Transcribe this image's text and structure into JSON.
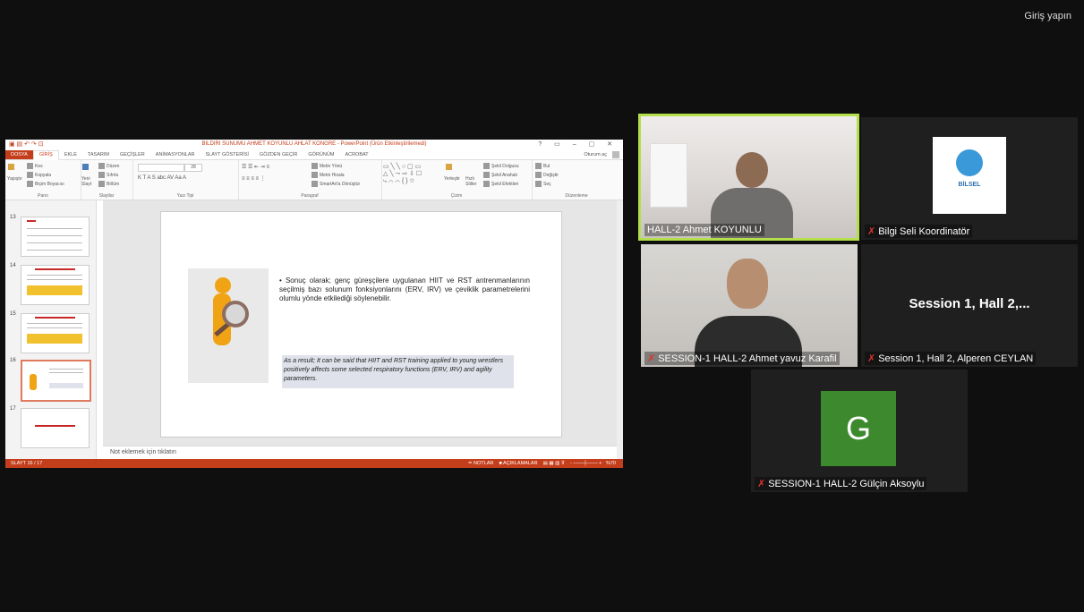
{
  "header": {
    "signin_label": "Giriş yapın"
  },
  "ppt": {
    "window_title": "BILDIRI SUNUMU AHMET KOYUNLU AHLAT KONGRE - PowerPoint (Ürün Etkinleştirilemedi)",
    "tabs": [
      "DOSYA",
      "GİRİŞ",
      "EKLE",
      "TASARIM",
      "GEÇİŞLER",
      "ANİMASYONLAR",
      "SLAYT GÖSTERİSİ",
      "GÖZDEN GEÇİR",
      "GÖRÜNÜM",
      "ACROBAT"
    ],
    "account_label": "Oturum aç",
    "ribbon": {
      "paste": "Yapıştır",
      "cut": "Kes",
      "copy": "Kopyala",
      "format_painter": "Biçim Boyacısı",
      "new_slide": "Yeni Slayt",
      "layout": "Düzen",
      "reset": "Sıfırla",
      "section": "Bölüm",
      "font_size": "28",
      "text_direction": "Metin Yönü",
      "align_text": "Metni Hizala",
      "smartart": "SmartArt'a Dönüştür",
      "arrange": "Yerleştir",
      "quick_styles": "Hızlı Stiller",
      "shape_fill": "Şekil Dolgusu",
      "shape_outline": "Şekil Anahatı",
      "shape_effects": "Şekil Efektleri",
      "find": "Bul",
      "replace": "Değiştir",
      "select": "Seç",
      "groups": [
        "Pano",
        "Slaytlar",
        "Yazı Tipi",
        "Paragraf",
        "Çizim",
        "Düzenleme"
      ]
    },
    "thumbnails": [
      {
        "num": "13"
      },
      {
        "num": "14"
      },
      {
        "num": "15"
      },
      {
        "num": "16"
      },
      {
        "num": "17"
      }
    ],
    "slide": {
      "bullet_text": "Sonuç olarak; genç güreşçilere uygulanan HIIT ve RST antrenmanlarının seçilmiş bazı solunum fonksiyonlarını (ERV, IRV) ve çeviklik parametrelerini olumlu yönde etkilediği söylenebilir.",
      "english_text": "As a result; It can be said that HIIT and RST training applied to young wrestlers positively affects some selected respiratory functions (ERV, IRV) and agility parameters."
    },
    "notes_placeholder": "Not eklemek için tıklatın",
    "status": {
      "slide_counter": "SLAYT 16 / 17",
      "notes": "NOTLAR",
      "comments": "AÇIKLAMALAR",
      "zoom": "%70"
    }
  },
  "participants": [
    {
      "name": "HALL-2 Ahmet KOYUNLU",
      "speaking": true
    },
    {
      "name": "Bilgi Seli Koordinatör",
      "logo_text": "BİLSEL"
    },
    {
      "name": "SESSION-1 HALL-2 Ahmet yavuz Karafil"
    },
    {
      "name": "Session 1, Hall 2, Alperen CEYLAN",
      "display_title": "Session 1, Hall 2,..."
    },
    {
      "name": "SESSION-1 HALL-2  Gülçin Aksoylu",
      "initial": "G"
    }
  ],
  "colors": {
    "ppt_accent": "#c43e1c",
    "speaker_border": "#b3e04a",
    "avatar_green": "#3d8a2e",
    "muted_red": "#e0322b"
  }
}
